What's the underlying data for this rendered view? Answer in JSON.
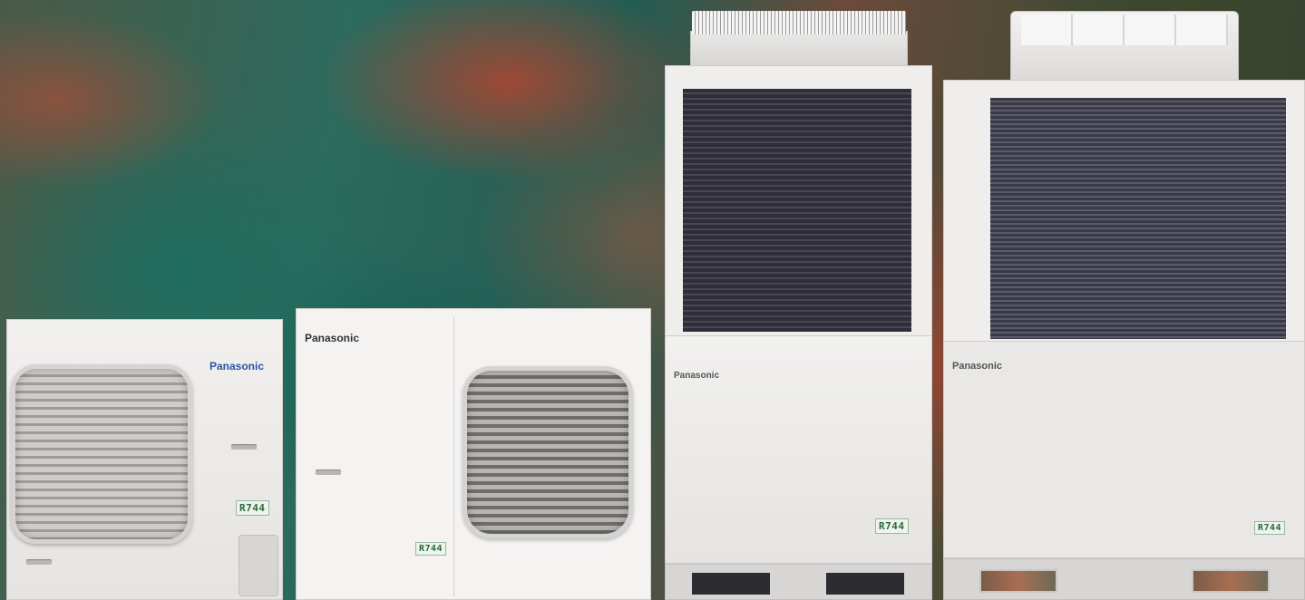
{
  "products": [
    {
      "id": "unit-1",
      "brand": "Panasonic",
      "refrigerant_label": "R744",
      "brand_color": "#2b55a5"
    },
    {
      "id": "unit-2",
      "brand": "Panasonic",
      "refrigerant_label": "R744",
      "brand_color": "#333333"
    },
    {
      "id": "unit-3",
      "brand": "Panasonic",
      "refrigerant_label": "R744",
      "brand_color": "#555555"
    },
    {
      "id": "unit-4",
      "brand": "Panasonic",
      "refrigerant_label": "R744",
      "brand_color": "#555555"
    }
  ],
  "background": {
    "description_colors": [
      "#235c52",
      "#a8503a",
      "#3d4a35"
    ]
  }
}
